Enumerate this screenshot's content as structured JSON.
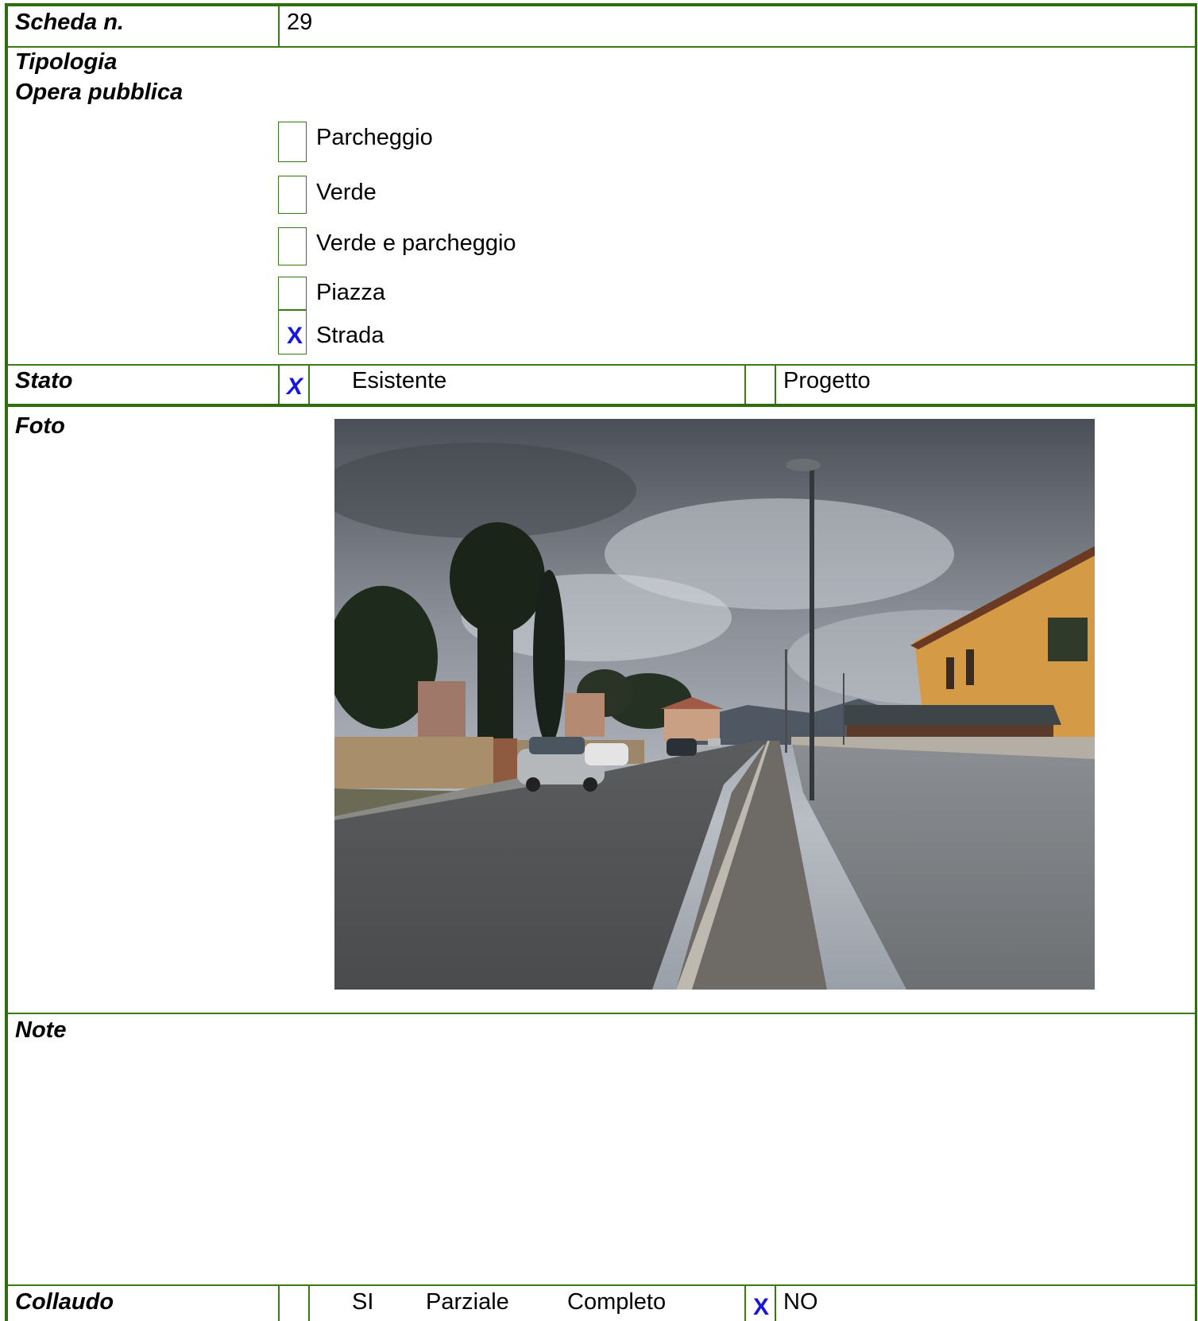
{
  "scheda": {
    "label": "Scheda n.",
    "number": "29"
  },
  "tipologia": {
    "label_line1": "Tipologia",
    "label_line2": "Opera pubblica",
    "options": [
      {
        "label": "Parcheggio",
        "checked": false
      },
      {
        "label": "Verde",
        "checked": false
      },
      {
        "label": "Verde e parcheggio",
        "checked": false
      },
      {
        "label": "Piazza",
        "checked": false
      },
      {
        "label": "Strada",
        "checked": true,
        "mark": "X"
      }
    ]
  },
  "stato": {
    "label": "Stato",
    "esistente": {
      "label": "Esistente",
      "checked": true,
      "mark": "X"
    },
    "progetto": {
      "label": "Progetto",
      "checked": false
    }
  },
  "foto": {
    "label": "Foto"
  },
  "note": {
    "label": "Note"
  },
  "collaudo": {
    "label": "Collaudo",
    "si_label": "SI",
    "parziale_label": "Parziale",
    "completo_label": "Completo",
    "si_checked": false,
    "no": {
      "label": "NO",
      "checked": true,
      "mark": "X"
    }
  },
  "colors": {
    "border": "#3a7a10",
    "mark": "#1616e0"
  }
}
